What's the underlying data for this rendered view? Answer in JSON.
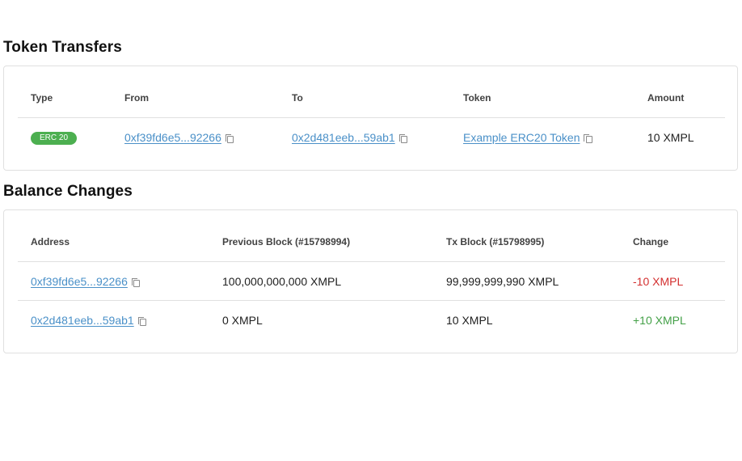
{
  "token_transfers": {
    "title": "Token Transfers",
    "columns": [
      "Type",
      "From",
      "To",
      "Token",
      "Amount"
    ],
    "rows": [
      {
        "type": "ERC 20",
        "from": "0xf39fd6e5...92266",
        "to": "0x2d481eeb...59ab1",
        "token": "Example ERC20 Token",
        "amount": "10 XMPL"
      }
    ]
  },
  "balance_changes": {
    "title": "Balance Changes",
    "columns": [
      "Address",
      "Previous Block (#15798994)",
      "Tx Block (#15798995)",
      "Change"
    ],
    "rows": [
      {
        "address": "0xf39fd6e5...92266",
        "previous": "100,000,000,000 XMPL",
        "tx_block": "99,999,999,990 XMPL",
        "change": "-10 XMPL"
      },
      {
        "address": "0x2d481eeb...59ab1",
        "previous": "0 XMPL",
        "tx_block": "10 XMPL",
        "change": "+10 XMPL"
      }
    ]
  },
  "colors": {
    "link": "#4a90c8",
    "badge": "#4caf50",
    "negative": "#d32f2f",
    "positive": "#43a047"
  }
}
